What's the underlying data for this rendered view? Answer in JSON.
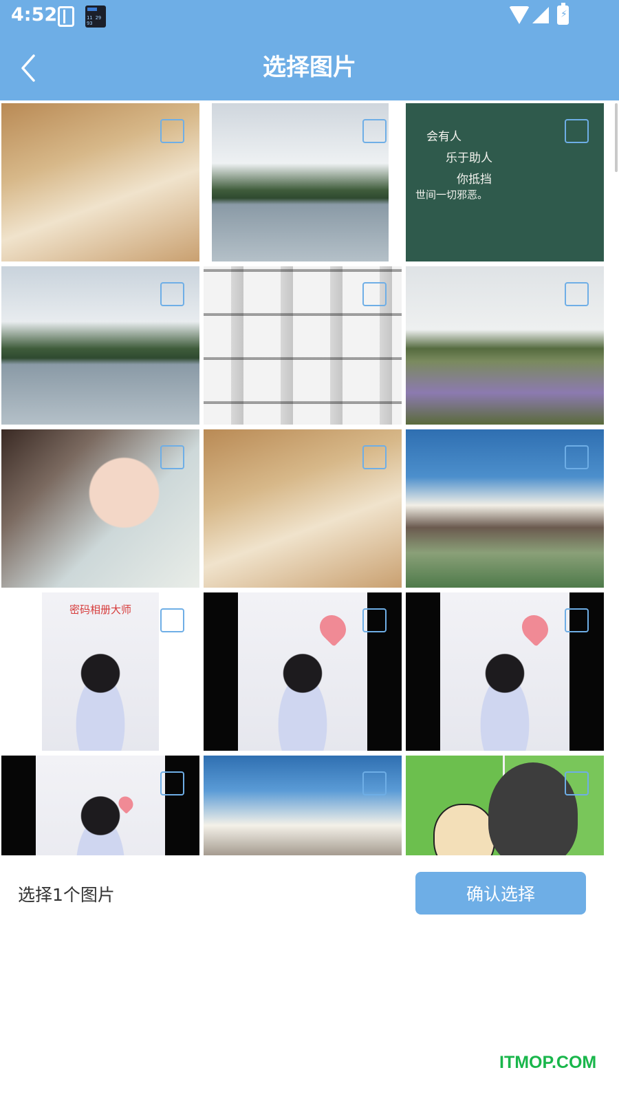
{
  "status_bar": {
    "time": "4:52",
    "icons": [
      "phone-outline-icon",
      "app-notification-icon",
      "wifi-icon",
      "cell-signal-icon",
      "battery-charging-icon"
    ]
  },
  "header": {
    "title": "选择图片",
    "back_icon": "chevron-left-icon",
    "background_color": "#6eaee6"
  },
  "grid": {
    "columns": 3,
    "tiles": [
      {
        "name": "photo-reading-tea"
      },
      {
        "name": "photo-lake-hat-framed"
      },
      {
        "name": "photo-chalkboard-quote",
        "lines": [
          "会有人",
          "乐于助人",
          "你抵挡",
          "世间一切邪恶。"
        ]
      },
      {
        "name": "photo-lake-hat"
      },
      {
        "name": "photo-architecture"
      },
      {
        "name": "photo-field-two-girls"
      },
      {
        "name": "photo-painted-portrait"
      },
      {
        "name": "photo-reading-tea-2"
      },
      {
        "name": "photo-mountain-clouds"
      },
      {
        "name": "photo-poster-caption",
        "caption": "密码相册大师"
      },
      {
        "name": "photo-poster-hearts"
      },
      {
        "name": "photo-poster-hearts-2"
      },
      {
        "name": "photo-poster-flower"
      },
      {
        "name": "photo-sky-clouds"
      },
      {
        "name": "photo-cartoon-dogs"
      }
    ],
    "checkbox_checked": false
  },
  "footer": {
    "selected_count_text": "选择1个图片",
    "confirm_label": "确认选择"
  },
  "watermark": "ITMOP.COM",
  "colors": {
    "accent": "#6eaee6",
    "watermark": "#19b64b"
  }
}
